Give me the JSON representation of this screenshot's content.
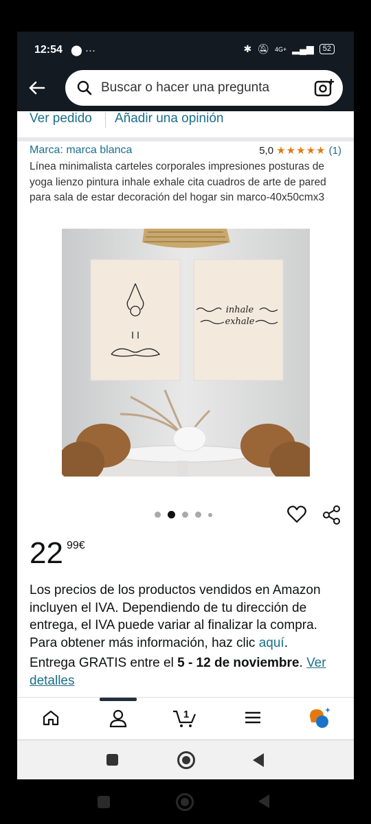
{
  "status": {
    "time": "12:54",
    "network": "4G+",
    "battery": "52"
  },
  "search": {
    "placeholder": "Buscar o hacer una pregunta"
  },
  "links": {
    "order": "Ver pedido",
    "review": "Añadir una opinión"
  },
  "product": {
    "brand": "Marca: marca blanca",
    "rating_value": "5,0",
    "stars": "★★★★★",
    "rating_count": "(1)",
    "title": "Línea minimalista carteles corporales impresiones posturas de yoga lienzo pintura inhale exhale cita cuadros de arte de pared para sala de estar decoración del hogar sin marco-40x50cmx3",
    "image_text_line1": "inhale",
    "image_text_line2": "exhale",
    "image_count": 5,
    "active_image": 2
  },
  "price": {
    "whole": "22",
    "fraction": "99",
    "currency": "€"
  },
  "tax": {
    "text": "Los precios de los productos vendidos en Amazon incluyen el IVA. Dependiendo de tu dirección de entrega, el IVA puede variar al finalizar la compra. Para obtener más información, haz clic",
    "link": "aquí",
    "end": "."
  },
  "delivery": {
    "prefix": "Entrega GRATIS entre el",
    "dates": "5 - 12 de noviembre",
    "sep": ".",
    "link": "Ver detalles"
  },
  "tabs": {
    "cart_count": "1"
  },
  "colors": {
    "header": "#131a22",
    "link": "#1a6f8c",
    "star": "#e47911"
  }
}
